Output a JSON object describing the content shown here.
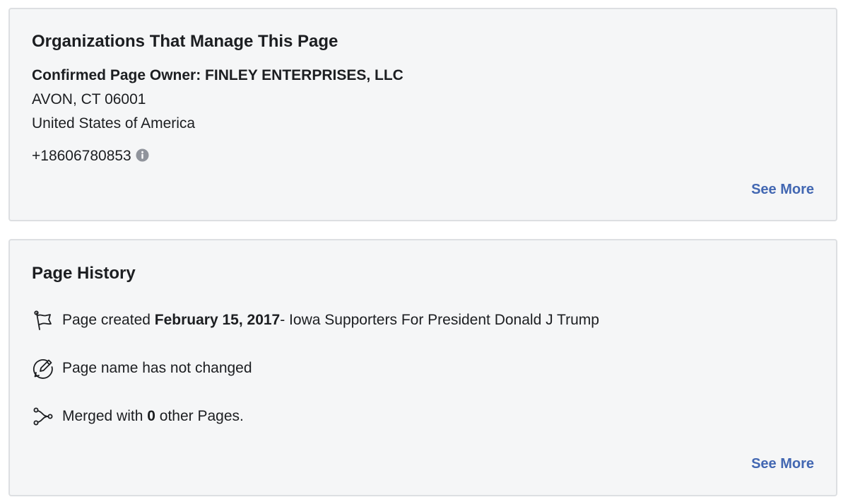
{
  "organizations": {
    "title": "Organizations That Manage This Page",
    "owner_label": "Confirmed Page Owner: FINLEY ENTERPRISES, LLC",
    "address_line1": "AVON, CT 06001",
    "address_line2": "United States of America",
    "phone": "+18606780853",
    "see_more": "See More"
  },
  "history": {
    "title": "Page History",
    "created_prefix": "Page created",
    "created_date": "February 15, 2017",
    "created_suffix": " - Iowa Supporters For President Donald J Trump",
    "name_status": "Page name has not changed",
    "merged_prefix": "Merged with",
    "merged_count": "0",
    "merged_suffix": "other Pages.",
    "see_more": "See More"
  },
  "icons": {
    "phone_info": "info-icon",
    "created": "flag-icon",
    "name": "edit-pencil-icon",
    "merged": "merge-icon"
  },
  "colors": {
    "card_background": "#f5f6f7",
    "card_border": "#dddfe2",
    "link": "#4267b2",
    "text": "#1c1e21",
    "icon_gray": "#90949c"
  }
}
